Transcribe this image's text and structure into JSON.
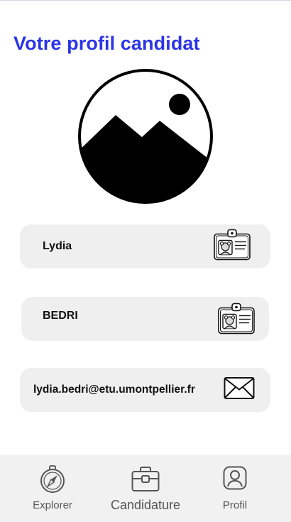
{
  "page": {
    "title": "Votre profil candidat"
  },
  "avatar": {
    "icon": "image-placeholder-icon"
  },
  "fields": {
    "first_name": {
      "value": "Lydia",
      "icon": "id-badge-icon"
    },
    "last_name": {
      "value": "BEDRI",
      "icon": "id-badge-icon"
    },
    "email": {
      "value": "lydia.bedri@etu.umontpellier.fr",
      "icon": "envelope-icon"
    }
  },
  "nav": {
    "explorer": {
      "label": "Explorer",
      "icon": "compass-icon"
    },
    "candidature": {
      "label": "Candidature",
      "icon": "briefcase-icon"
    },
    "profil": {
      "label": "Profil",
      "icon": "user-icon"
    }
  },
  "colors": {
    "accent": "#2b34e6",
    "field_background": "#efefef",
    "navbar_background": "#f1f1f1"
  }
}
